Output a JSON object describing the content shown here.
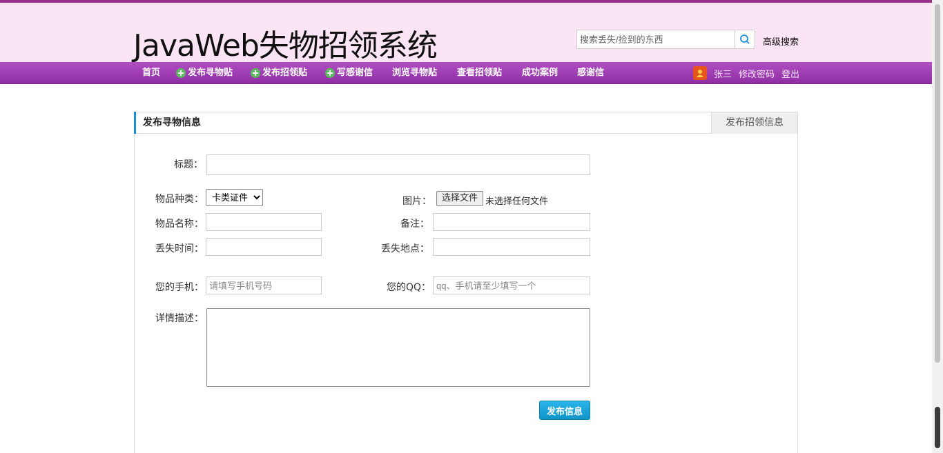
{
  "header": {
    "logo": "JavaWeb失物招领系统",
    "search_placeholder": "搜索丢失/捡到的东西",
    "advanced_search": "高级搜索"
  },
  "nav": {
    "items": [
      {
        "label": "首页",
        "icon": null
      },
      {
        "label": "发布寻物贴",
        "icon": "plus-circle-icon"
      },
      {
        "label": "发布招领贴",
        "icon": "plus-circle-icon"
      },
      {
        "label": "写感谢信",
        "icon": "plus-circle-icon"
      },
      {
        "label": "浏览寻物贴",
        "icon": null
      },
      {
        "label": "查看招领贴",
        "icon": null
      },
      {
        "label": "成功案例",
        "icon": null
      },
      {
        "label": "感谢信",
        "icon": null
      }
    ],
    "user": {
      "name": "张三",
      "change_password": "修改密码",
      "logout": "登出"
    }
  },
  "panel": {
    "title": "发布寻物信息",
    "tab": "发布招领信息"
  },
  "form": {
    "title_label": "标题：",
    "category_label": "物品种类：",
    "category_value": "卡类证件",
    "image_label": "图片：",
    "file_button": "选择文件",
    "file_status": "未选择任何文件",
    "name_label": "物品名称：",
    "remark_label": "备注：",
    "lost_time_label": "丢失时间：",
    "lost_place_label": "丢失地点：",
    "phone_label": "您的手机：",
    "phone_placeholder": "请填写手机号码",
    "qq_label": "您的QQ：",
    "qq_placeholder": "qq、手机请至少填写一个",
    "desc_label": "详情描述：",
    "submit": "发布信息"
  },
  "colors": {
    "header_bg": "#fbe4f4",
    "nav_bg": "#a03eb4",
    "accent_blue": "#1a8dd8",
    "submit_bg": "#16a3db"
  }
}
